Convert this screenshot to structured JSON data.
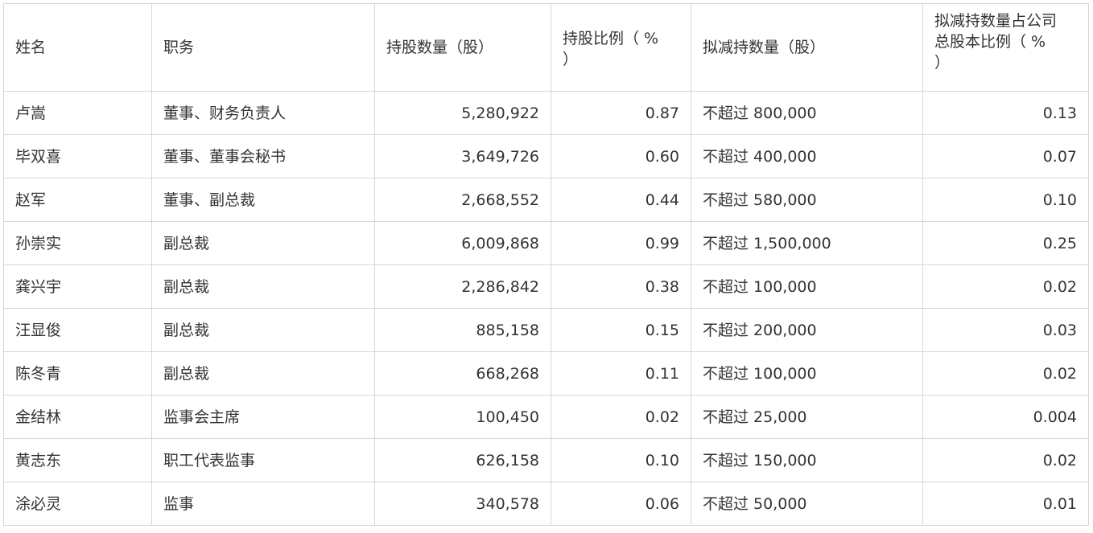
{
  "table": {
    "headers": [
      "姓名",
      "职务",
      "持股数量（股）",
      "持股比例（ % ）",
      "拟减持数量（股）",
      "拟减持数量占公司总股本比例（ % ）"
    ],
    "header_lines": {
      "ratio": [
        "持股比例（ %",
        "）"
      ],
      "reduce_ratio": [
        "拟减持数量占公司",
        "总股本比例（ %",
        "）"
      ]
    },
    "rows": [
      [
        "卢嵩",
        "董事、财务负责人",
        "5,280,922",
        "0.87",
        "不超过 800,000",
        "0.13"
      ],
      [
        "毕双喜",
        "董事、董事会秘书",
        "3,649,726",
        "0.60",
        "不超过 400,000",
        "0.07"
      ],
      [
        "赵军",
        "董事、副总裁",
        "2,668,552",
        "0.44",
        "不超过 580,000",
        "0.10"
      ],
      [
        "孙崇实",
        "副总裁",
        "6,009,868",
        "0.99",
        "不超过 1,500,000",
        "0.25"
      ],
      [
        "龚兴宇",
        "副总裁",
        "2,286,842",
        "0.38",
        "不超过 100,000",
        "0.02"
      ],
      [
        "汪显俊",
        "副总裁",
        "885,158",
        "0.15",
        "不超过 200,000",
        "0.03"
      ],
      [
        "陈冬青",
        "副总裁",
        "668,268",
        "0.11",
        "不超过 100,000",
        "0.02"
      ],
      [
        "金结林",
        "监事会主席",
        "100,450",
        "0.02",
        "不超过 25,000",
        "0.004"
      ],
      [
        "黄志东",
        "职工代表监事",
        "626,158",
        "0.10",
        "不超过 150,000",
        "0.02"
      ],
      [
        "涂必灵",
        "监事",
        "340,578",
        "0.06",
        "不超过 50,000",
        "0.01"
      ]
    ]
  },
  "colors": {
    "border": "#d6d6d6",
    "text": "#333333",
    "background": "#ffffff"
  }
}
